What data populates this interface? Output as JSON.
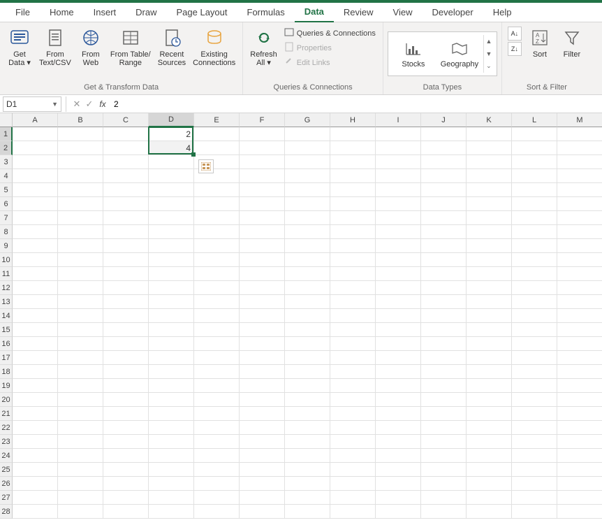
{
  "colors": {
    "accent": "#217346"
  },
  "tabs": [
    "File",
    "Home",
    "Insert",
    "Draw",
    "Page Layout",
    "Formulas",
    "Data",
    "Review",
    "View",
    "Developer",
    "Help"
  ],
  "active_tab": "Data",
  "ribbon": {
    "get_transform": {
      "label": "Get & Transform Data",
      "buttons": {
        "get_data": "Get\nData ▾",
        "from_text": "From\nText/CSV",
        "from_web": "From\nWeb",
        "from_table": "From Table/\nRange",
        "recent": "Recent\nSources",
        "existing": "Existing\nConnections"
      }
    },
    "queries": {
      "label": "Queries & Connections",
      "refresh": "Refresh\nAll ▾",
      "qc": "Queries & Connections",
      "props": "Properties",
      "edit_links": "Edit Links"
    },
    "datatypes": {
      "label": "Data Types",
      "stocks": "Stocks",
      "geography": "Geography"
    },
    "sortfilter": {
      "label": "Sort & Filter",
      "sort": "Sort",
      "filter": "Filter"
    }
  },
  "namebox": "D1",
  "formula": "2",
  "columns": [
    "A",
    "B",
    "C",
    "D",
    "E",
    "F",
    "G",
    "H",
    "I",
    "J",
    "K",
    "L",
    "M"
  ],
  "row_count": 28,
  "cells": {
    "D1": "2",
    "D2": "4"
  },
  "selection": {
    "col": "D",
    "rows": [
      1,
      2
    ]
  }
}
